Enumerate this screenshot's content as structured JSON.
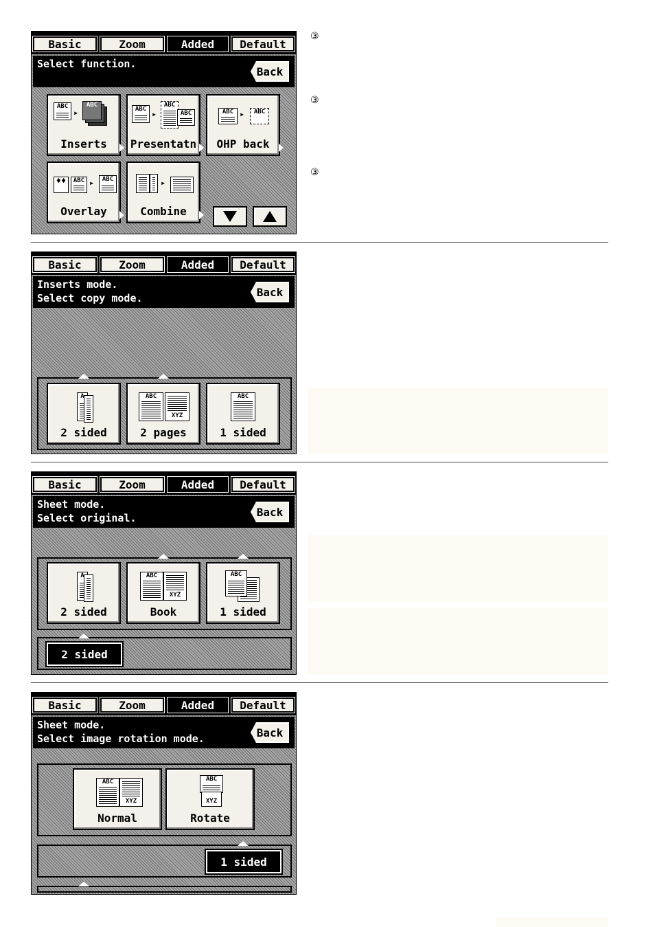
{
  "tabs": {
    "basic": "Basic",
    "zoom": "Zoom",
    "added": "Added",
    "default": "Default"
  },
  "back_label": "Back",
  "circled_marker": "③",
  "panel1": {
    "message": [
      "Select function."
    ],
    "buttons": [
      "Inserts",
      "Presentatn",
      "OHP back",
      "Overlay",
      "Combine"
    ]
  },
  "panel2": {
    "message": [
      "Inserts mode.",
      "Select copy mode."
    ],
    "buttons": [
      "2 sided",
      "2 pages",
      "1 sided"
    ]
  },
  "panel3": {
    "message": [
      "Sheet mode.",
      "Select original."
    ],
    "buttons": [
      "2 sided",
      "Book",
      "1 sided"
    ],
    "selected": "2 sided"
  },
  "panel4": {
    "message": [
      "Sheet mode.",
      "Select image rotation mode."
    ],
    "buttons": [
      "Normal",
      "Rotate"
    ],
    "selected": "1 sided"
  },
  "icons": {
    "down": "down-triangle-icon",
    "up": "up-triangle-icon"
  },
  "colors": {
    "screen_bg": "#808080",
    "button_face": "#f3f1ea",
    "note_bg": "#fdf9f3"
  }
}
